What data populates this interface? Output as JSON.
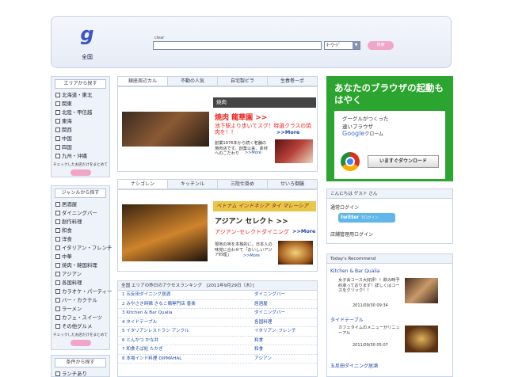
{
  "header": {
    "logo": "g",
    "region": "全国",
    "clear_label": "clear",
    "search_mode": "ｷｰﾜｰﾄﾞ",
    "search_button": "検索"
  },
  "area_box": {
    "title": "エリアから探す",
    "items": [
      "北海道・東北",
      "関東",
      "北陸・甲信越",
      "東海",
      "関西",
      "中国",
      "四国",
      "九州・沖縄"
    ],
    "note": "チェックしたお店だけをまとめて"
  },
  "genre_box": {
    "title": "ジャンルから探す",
    "items": [
      "居酒屋",
      "ダイニングバー",
      "創作料理",
      "和食",
      "洋食",
      "イタリアン・フレンチ",
      "中華",
      "焼肉・韓国料理",
      "アジアン",
      "各国料理",
      "カラオケ・パーティー",
      "バー・カクテル",
      "ラーメン",
      "カフェ・スイーツ",
      "その他グルメ"
    ],
    "note": "チェックしたお店だけをまとめて"
  },
  "cond_box": {
    "title": "条件から探す",
    "items": [
      "ランチあり"
    ]
  },
  "tabs1": [
    "銀座周辺カル",
    "不動の人気",
    "自宅製ビラ",
    "生春巻ーポ"
  ],
  "feature1": {
    "category": "焼肉",
    "shop": "焼肉 龍華園 >>",
    "catch": "池下駅より歩いてスグ！特選クラスの焼肉を！！",
    "more": ">>More",
    "desc": "創業1976年から続く老舗の焼肉店です。創業以来、素材へのこだわり",
    "desc_more": ">>More"
  },
  "tabs2": [
    "ナシゴレン",
    "キッチンル",
    "三陸仕掛め",
    "せいろ御膳"
  ],
  "feature2": {
    "category": "ベトナム インドネシア タイ マレーシア",
    "shop": "アジアン セレクト >>",
    "catch": "アジアン･セレクトダイニング",
    "more": ">>More",
    "desc": "現地の味を本格的に。日本人の味覚に合わせて「おいしいアジア料理」",
    "desc_more": ">>More"
  },
  "ranking": {
    "header": "全国 エリアの昨日のアクセスランキング　[2011年9月29日（木）]",
    "rows": [
      {
        "name": "1 五反田ダイニング居酒",
        "genre": "ダイニングバー"
      },
      {
        "name": "2 みやさき時鶏 きなこ鶏専門店 香楽",
        "genre": "居酒屋"
      },
      {
        "name": "3 Kitchen & Bar Qualia",
        "genre": "ダイニングバー"
      },
      {
        "name": "4 タイドテーブル",
        "genre": "各国料理"
      },
      {
        "name": "5 イタリアンレストラン アンクル",
        "genre": "イタリアン･フレンチ"
      },
      {
        "name": "6 とんかつ かな井",
        "genre": "和食"
      },
      {
        "name": "7 和食そば処 たかぎ",
        "genre": "和食"
      },
      {
        "name": "8 本場インド料理 DIPMAHAL",
        "genre": "アジアン"
      }
    ]
  },
  "ad": {
    "headline": "あなたのブラウザの起動もはやく",
    "sub1": "グーグルがつくった",
    "sub2": "速いブラウザ",
    "brand": "Google",
    "brand_suffix": "クローム",
    "download": "いますぐダウンロード"
  },
  "login": {
    "header": "こんにちは ゲスト さん",
    "normal": "通常ログイン",
    "twitter": "twitter",
    "twitter_login": "でログイン",
    "store": "店舗管理用ログイン"
  },
  "recommend": {
    "header": "Today's Recommend",
    "items": [
      {
        "title": "Kitchen & Bar Qualia",
        "text": "女子会コース大好評！！飲み時予約承っております！詳しくはコースをクリック！！",
        "date": "2011/09/30 09:34"
      },
      {
        "title": "タイドテーブル",
        "text": "カフェタイムのメニューがリニューアル",
        "date": "2011/09/30 05:07"
      },
      {
        "title": "五反田ダイニング居酒",
        "text": "",
        "date": ""
      }
    ]
  },
  "colors": {
    "accent_pink": "#f0a6c8",
    "link_blue": "#1b49a6",
    "promo_red": "#e8251d",
    "ad_green": "#2ba52f"
  }
}
